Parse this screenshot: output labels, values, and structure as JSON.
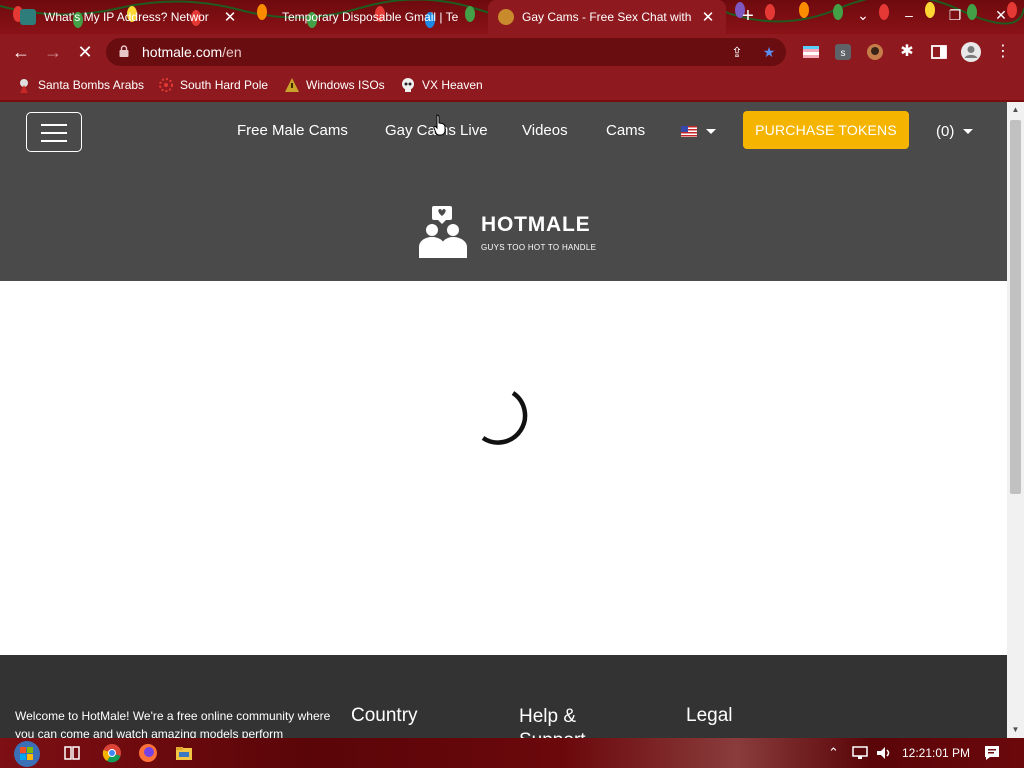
{
  "browser": {
    "tabs": [
      {
        "title": "What's My IP Address? Networ",
        "favicon_color": "#2e7d7a",
        "active": false
      },
      {
        "title": "Temporary Disposable Gmail | Te",
        "favicon_color": "#e0e0e0",
        "active": false
      },
      {
        "title": "Gay Cams - Free Sex Chat with S",
        "favicon_color": "#c98a2d",
        "active": true
      }
    ],
    "new_tab_label": "+",
    "url_host": "hotmale.com",
    "url_path": "/en",
    "bookmarks": [
      {
        "label": "Santa Bombs Arabs"
      },
      {
        "label": "South Hard Pole"
      },
      {
        "label": "Windows ISOs"
      },
      {
        "label": "VX Heaven"
      }
    ],
    "window_controls": {
      "minimize": "–",
      "restore": "❐",
      "close": "✕",
      "tab_search": "⌄"
    }
  },
  "site": {
    "nav": [
      "Free Male Cams",
      "Gay Cams Live",
      "Videos",
      "Cams"
    ],
    "purchase_label": "PURCHASE TOKENS",
    "cart_count": "(0)",
    "logo_name": "HOTMALE",
    "logo_tagline": "GUYS TOO HOT TO HANDLE",
    "footer": {
      "about": "Welcome to HotMale! We're a free online community where you can come and watch amazing models perform",
      "columns": [
        "Country",
        "Help & Support",
        "Legal"
      ]
    },
    "colors": {
      "header": "#4a4a4a",
      "accent": "#f4b400",
      "footer": "#333333"
    }
  },
  "taskbar": {
    "clock": "12:21:01 PM"
  }
}
